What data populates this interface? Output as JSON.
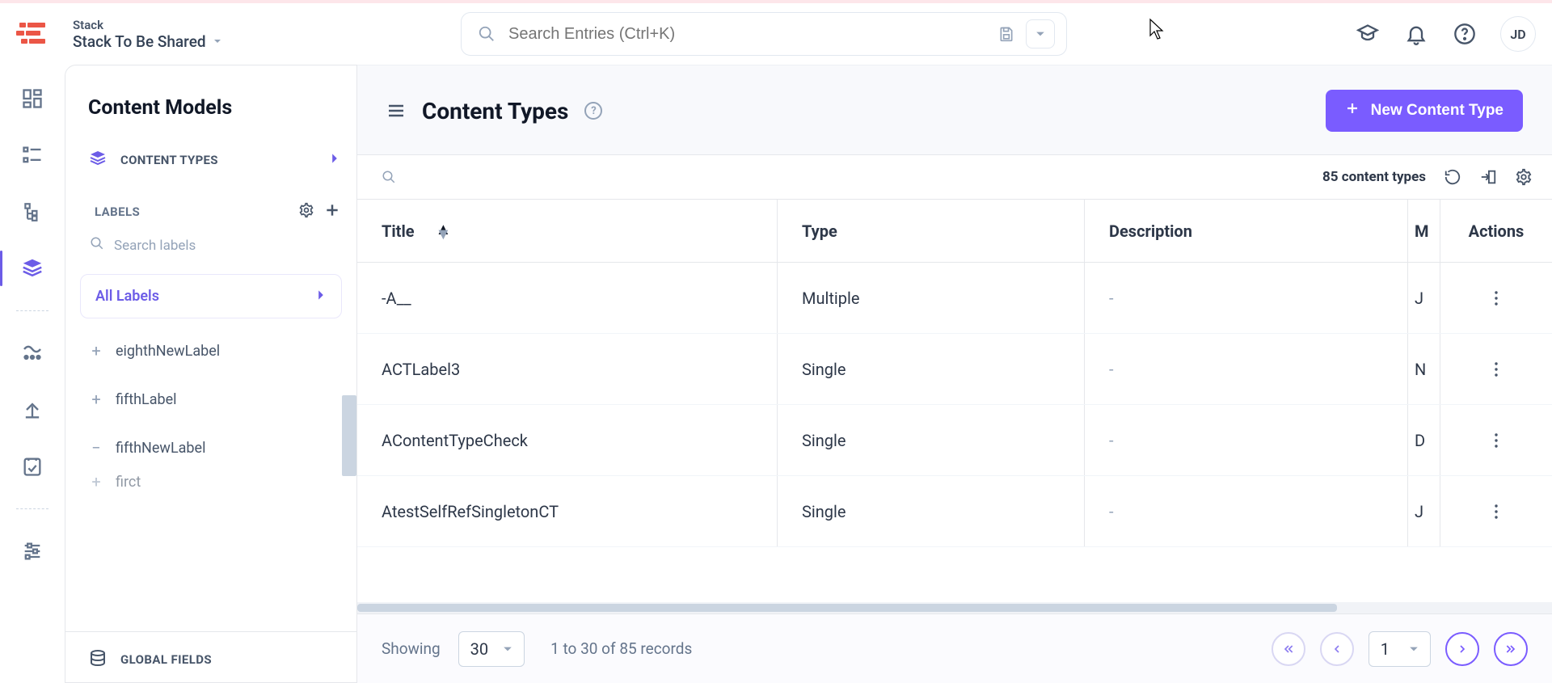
{
  "header": {
    "eyebrow": "Stack",
    "stack_name": "Stack To Be Shared",
    "search_placeholder": "Search Entries (Ctrl+K)",
    "avatar_initials": "JD"
  },
  "sidebar": {
    "title": "Content Models",
    "content_types_label": "CONTENT TYPES",
    "labels_header": "LABELS",
    "search_labels_placeholder": "Search labels",
    "all_labels": "All Labels",
    "labels": [
      {
        "symbol": "+",
        "name": "eighthNewLabel"
      },
      {
        "symbol": "+",
        "name": "fifthLabel"
      },
      {
        "symbol": "−",
        "name": "fifthNewLabel"
      },
      {
        "symbol": "+",
        "name": "firct"
      }
    ],
    "global_fields_label": "GLOBAL FIELDS"
  },
  "main": {
    "title": "Content Types",
    "new_button": "New Content Type",
    "count_label": "85 content types",
    "columns": {
      "title": "Title",
      "type": "Type",
      "description": "Description",
      "m": "M",
      "actions": "Actions"
    },
    "rows": [
      {
        "title": "-A__",
        "type": "Multiple",
        "description": "-",
        "m": "J"
      },
      {
        "title": "ACTLabel3",
        "type": "Single",
        "description": "-",
        "m": "N"
      },
      {
        "title": "AContentTypeCheck",
        "type": "Single",
        "description": "-",
        "m": "D"
      },
      {
        "title": "AtestSelfRefSingletonCT",
        "type": "Single",
        "description": "-",
        "m": "J"
      }
    ],
    "pager": {
      "showing": "Showing",
      "size": "30",
      "range": "1 to 30 of 85 records",
      "page": "1"
    }
  }
}
